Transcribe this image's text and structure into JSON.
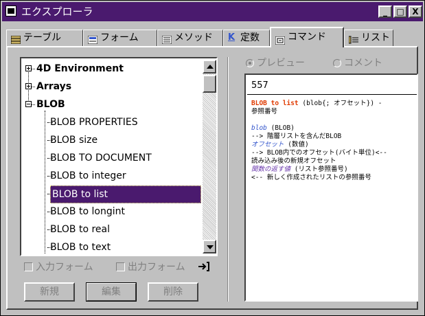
{
  "window": {
    "title": "エクスプローラ",
    "controls": [
      "_",
      "□",
      "X"
    ]
  },
  "tabs": [
    {
      "label": "テーブル",
      "icon": "table-icon"
    },
    {
      "label": "フォーム",
      "icon": "form-icon"
    },
    {
      "label": "メソッド",
      "icon": "method-icon"
    },
    {
      "label": "定数",
      "icon": "constant-k-icon"
    },
    {
      "label": "コマンド",
      "icon": "command-icon",
      "active": true
    },
    {
      "label": "リスト",
      "icon": "list-icon"
    }
  ],
  "tree": {
    "nodes": [
      {
        "label": "4D Environment",
        "expanded": false
      },
      {
        "label": "Arrays",
        "expanded": false
      },
      {
        "label": "BLOB",
        "expanded": true
      }
    ],
    "children": [
      "BLOB PROPERTIES",
      "BLOB size",
      "BLOB TO DOCUMENT",
      "BLOB to integer",
      "BLOB to list",
      "BLOB to longint",
      "BLOB to real",
      "BLOB to text"
    ],
    "selected": "BLOB to list"
  },
  "checkboxes": {
    "input_form": "入力フォーム",
    "output_form": "出力フォーム"
  },
  "buttons": {
    "new": "新規",
    "edit": "編集",
    "delete": "削除"
  },
  "preview": {
    "radio_preview": "プレビュー",
    "radio_comment": "コメント",
    "selected_mode": "プレビュー",
    "number": "557",
    "syntax_name": "BLOB to list",
    "syntax_args": " (blob{; オフセット}) -",
    "syntax_return": "参照番号",
    "p1_name": "blob",
    "p1_type": " (BLOB)",
    "p1_desc": "--> 階層リストを含んだBLOB",
    "p2_name": "オフセット",
    "p2_type": " (数値)",
    "p2_desc1": "--> BLOB内でのオフセット(バイト単位)<--",
    "p2_desc2": "読み込み後の新規オフセット",
    "ret_name": "関数の返す値",
    "ret_type": " (リスト参照番号)",
    "ret_desc": "<-- 新しく作成されたリストの参照番号"
  },
  "colors": {
    "titlebar": "#4a1a6e",
    "selection": "#4a1a6e",
    "command_name": "#e03a00",
    "param_name": "#3355cc",
    "return_name": "#6633aa"
  }
}
